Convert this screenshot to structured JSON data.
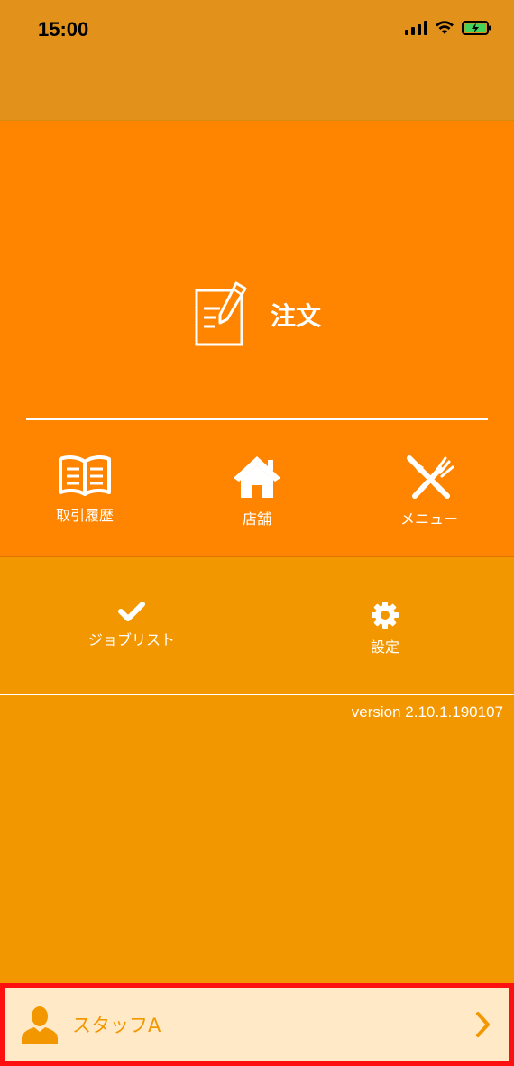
{
  "status_bar": {
    "time": "15:00"
  },
  "main": {
    "order_label": "注文",
    "nav": [
      {
        "label": "取引履歴",
        "icon": "book-icon"
      },
      {
        "label": "店舗",
        "icon": "home-icon"
      },
      {
        "label": "メニュー",
        "icon": "utensils-icon"
      }
    ]
  },
  "secondary": {
    "items": [
      {
        "label": "ジョブリスト",
        "icon": "check-icon"
      },
      {
        "label": "設定",
        "icon": "gear-icon"
      }
    ]
  },
  "version": "version 2.10.1.190107",
  "staff": {
    "name": "スタッフA",
    "icon": "person-icon"
  },
  "colors": {
    "header": "#E2921B",
    "primary_orange": "#FF8500",
    "secondary_orange": "#F39700",
    "staff_bar_bg": "#FFE9C7",
    "highlight_border": "#FF1010"
  }
}
